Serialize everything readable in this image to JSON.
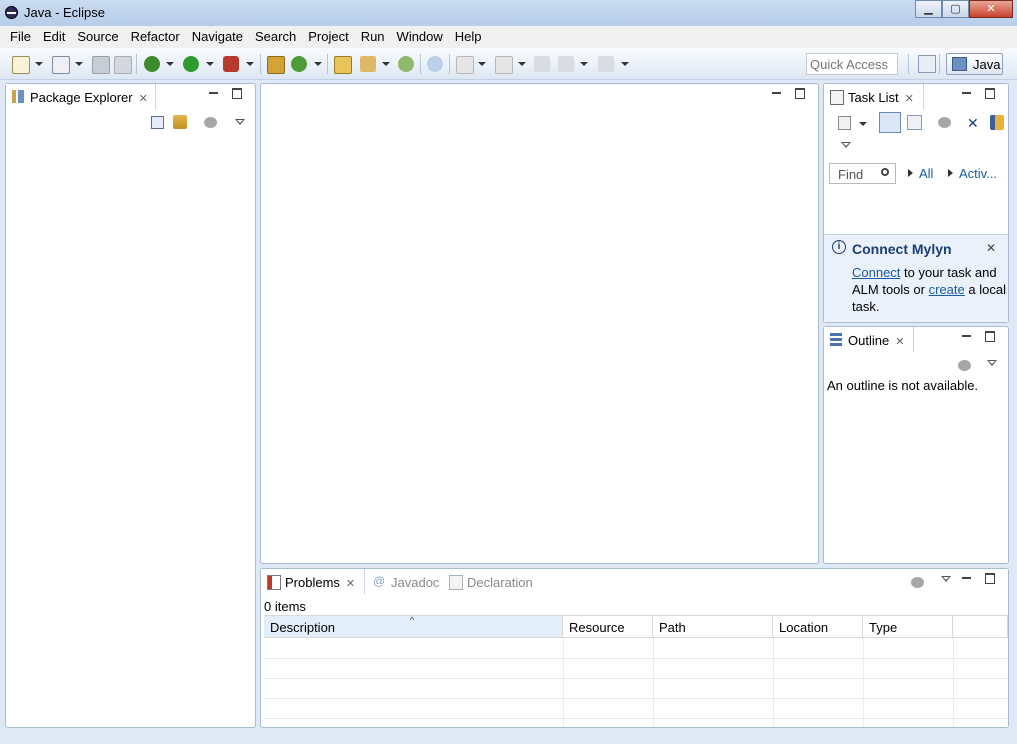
{
  "window": {
    "title": "Java - Eclipse",
    "minimize": "▁",
    "maximize": "▢",
    "close": "✕"
  },
  "menu": [
    "File",
    "Edit",
    "Source",
    "Refactor",
    "Navigate",
    "Search",
    "Project",
    "Run",
    "Window",
    "Help"
  ],
  "toolbar": {
    "quick_access_placeholder": "Quick Access",
    "perspective": "Java"
  },
  "package_explorer": {
    "tab_label": "Package Explorer"
  },
  "task_list": {
    "tab_label": "Task List",
    "find_placeholder": "Find",
    "filter_all": "All",
    "filter_active": "Activ...",
    "mylyn_title": "Connect Mylyn",
    "mylyn_connect_link": "Connect",
    "mylyn_text1": "to your task and ALM tools or",
    "mylyn_create_link": "create",
    "mylyn_text2": "a local task."
  },
  "outline": {
    "tab_label": "Outline",
    "message": "An outline is not available."
  },
  "bottom": {
    "tabs": [
      "Problems",
      "Javadoc",
      "Declaration"
    ],
    "count": "0 items",
    "columns": [
      "Description",
      "Resource",
      "Path",
      "Location",
      "Type"
    ]
  },
  "colors": {
    "frame": "#dfe8f5",
    "link": "#1a5aa6",
    "border": "#a9bcd6"
  }
}
